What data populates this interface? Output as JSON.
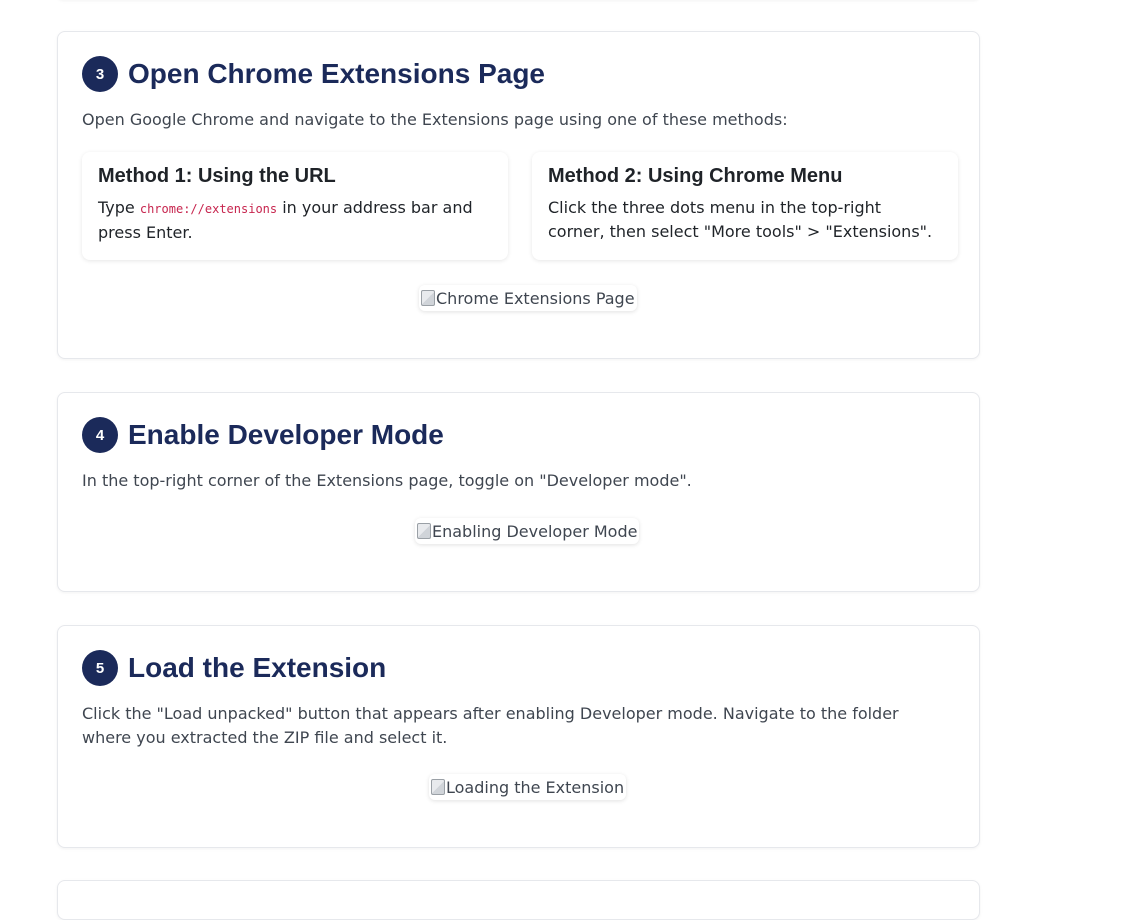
{
  "steps": [
    {
      "number": "3",
      "title": "Open Chrome Extensions Page",
      "description": "Open Google Chrome and navigate to the Extensions page using one of these methods:",
      "methods": [
        {
          "title": "Method 1: Using the URL",
          "text_before": "Type ",
          "code": "chrome://extensions",
          "text_after": " in your address bar and press Enter."
        },
        {
          "title": "Method 2: Using Chrome Menu",
          "text": "Click the three dots menu in the top-right corner, then select \"More tools\" > \"Extensions\"."
        }
      ],
      "image_alt": "Chrome Extensions Page"
    },
    {
      "number": "4",
      "title": "Enable Developer Mode",
      "description": "In the top-right corner of the Extensions page, toggle on \"Developer mode\".",
      "image_alt": "Enabling Developer Mode"
    },
    {
      "number": "5",
      "title": "Load the Extension",
      "description": "Click the \"Load unpacked\" button that appears after enabling Developer mode. Navigate to the folder where you extracted the ZIP file and select it.",
      "image_alt": "Loading the Extension"
    }
  ],
  "colors": {
    "accent": "#1b2a5a",
    "code": "#c7254e",
    "text": "#3f4650"
  },
  "icons": {
    "broken_image": "broken-image-icon"
  }
}
